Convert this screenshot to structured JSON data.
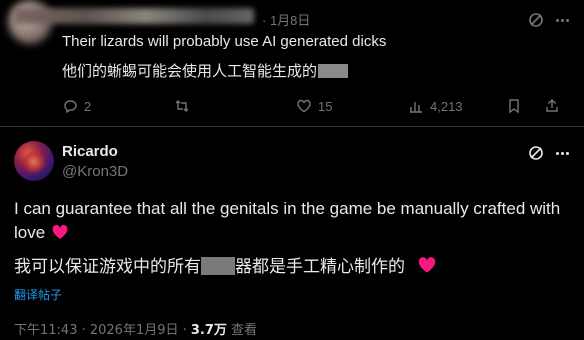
{
  "reply": {
    "date": "· 1月8日",
    "text_en": "Their lizards will probably use AI generated dicks",
    "text_zh": "他们的蜥蜴可能会使用人工智能生成的",
    "actions": {
      "reply_count": "2",
      "retweet_count": "",
      "like_count": "15",
      "view_count": "4,213"
    }
  },
  "main": {
    "name": "Ricardo",
    "handle": "@Kron3D",
    "text_en": "I can guarantee that all the genitals in the game be manually crafted with love",
    "text_zh_before": "我可以保证游戏中的所有",
    "text_zh_after": "器都是手工精心制作的",
    "translate_label": "翻译帖子",
    "time": "下午11:43 · 2026年1月9日 · ",
    "views": "3.7万",
    "views_label": " 查看"
  },
  "colors": {
    "background": "#000000",
    "text": "#e7e9ea",
    "muted": "#71767b",
    "link": "#1d9bf0",
    "heart": "#f91880"
  }
}
